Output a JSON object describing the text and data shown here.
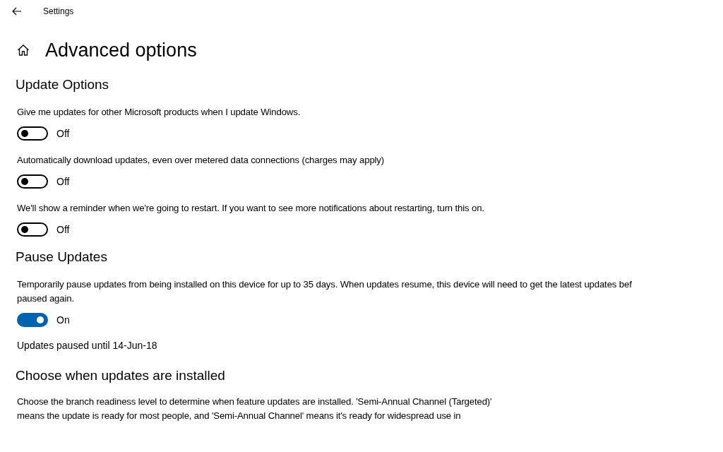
{
  "window": {
    "title": "Settings"
  },
  "page": {
    "title": "Advanced options"
  },
  "sections": [
    {
      "heading": "Update Options",
      "items": [
        {
          "kind": "toggle",
          "description": [
            "Give me updates for other Microsoft products when I update Windows."
          ],
          "on": false,
          "state_label": "Off"
        },
        {
          "kind": "toggle",
          "description": [
            "Automatically download updates, even over metered data connections (charges may apply)"
          ],
          "on": false,
          "state_label": "Off"
        },
        {
          "kind": "toggle",
          "description": [
            "We'll show a reminder when we're going to restart. If you want to see more notifications about restarting, turn this on."
          ],
          "on": false,
          "state_label": "Off"
        }
      ]
    },
    {
      "heading": "Pause Updates",
      "items": [
        {
          "kind": "toggle",
          "description": [
            "Temporarily pause updates from being installed on this device for up to 35 days. When updates resume, this device will need to get the latest updates bef",
            "paused again."
          ],
          "on": true,
          "state_label": "On"
        },
        {
          "kind": "note",
          "text": "Updates paused until 14-Jun-18"
        }
      ]
    },
    {
      "heading": "Choose when updates are installed",
      "items": [
        {
          "kind": "paragraph",
          "description": [
            "Choose the branch readiness level to determine when feature updates are installed. 'Semi-Annual Channel (Targeted)'",
            "means the update is ready for most people, and 'Semi-Annual Channel' means it's ready for widespread use in"
          ]
        }
      ]
    }
  ]
}
